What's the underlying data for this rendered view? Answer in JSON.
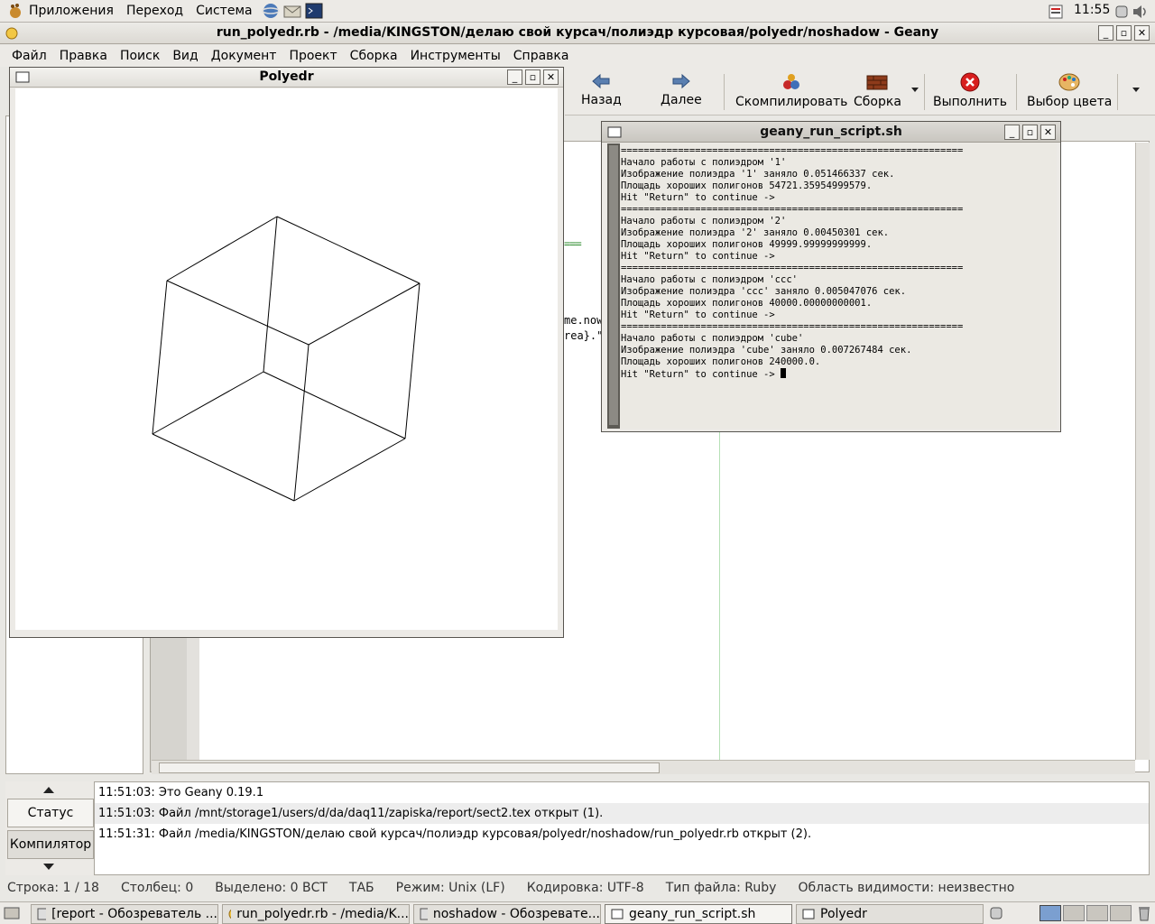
{
  "top_panel": {
    "menus": [
      "Приложения",
      "Переход",
      "Система"
    ],
    "clock": "11:55"
  },
  "geany": {
    "title": "run_polyedr.rb - /media/KINGSTON/делаю свой курсач/полиэдр курсовая/polyedr/noshadow - Geany",
    "menu": [
      "Файл",
      "Правка",
      "Поиск",
      "Вид",
      "Документ",
      "Проект",
      "Сборка",
      "Инструменты",
      "Справка"
    ],
    "toolbar": {
      "back": "Назад",
      "forward": "Далее",
      "compile": "Скомпилировать",
      "build": "Сборка",
      "execute": "Выполнить",
      "color": "Выбор цвета"
    },
    "code_fragments": [
      "me.now",
      "rea}.\""
    ],
    "messages": {
      "tabs": [
        "Статус",
        "Компилятор"
      ],
      "lines": [
        "11:51:03: Это Geany 0.19.1",
        "11:51:03: Файл /mnt/storage1/users/d/da/daq11/zapiska/report/sect2.tex открыт (1).",
        "11:51:31: Файл /media/KINGSTON/делаю свой курсач/полиэдр курсовая/polyedr/noshadow/run_polyedr.rb открыт (2)."
      ]
    },
    "statusbar": {
      "line": "Строка: 1 / 18",
      "col": "Столбец: 0",
      "sel": "Выделено: 0 ВСТ",
      "tab": "ТАБ",
      "mode": "Режим: Unix (LF)",
      "encoding": "Кодировка: UTF-8",
      "filetype": "Тип файла: Ruby",
      "scope": "Область видимости: неизвестно"
    }
  },
  "polyedr_window": {
    "title": "Polyedr"
  },
  "terminal": {
    "title": "geany_run_script.sh",
    "lines": [
      "============================================================",
      "Начало работы с полиэдром '1'",
      "Изображение полиэдра '1' заняло 0.051466337 сек.",
      "Площадь хороших полигонов 54721.35954999579.",
      "Hit \"Return\" to continue ->",
      "============================================================",
      "Начало работы с полиэдром '2'",
      "Изображение полиэдра '2' заняло 0.00450301 сек.",
      "Площадь хороших полигонов 49999.99999999999.",
      "Hit \"Return\" to continue ->",
      "============================================================",
      "Начало работы с полиэдром 'ccc'",
      "Изображение полиэдра 'ccc' заняло 0.005047076 сек.",
      "Площадь хороших полигонов 40000.00000000001.",
      "Hit \"Return\" to continue ->",
      "============================================================",
      "Начало работы с полиэдром 'cube'",
      "Изображение полиэдра 'cube' заняло 0.007267484 сек.",
      "Площадь хороших полигонов 240000.0.",
      "Hit \"Return\" to continue -> "
    ]
  },
  "taskbar": [
    "[report - Обозреватель ...",
    "run_polyedr.rb - /media/K...",
    "noshadow - Обозревате...",
    "geany_run_script.sh",
    "Polyedr"
  ],
  "colors": {
    "panel_bg": "#eceae6",
    "editor_guide": "#b6e0b6",
    "error_red": "#d81e1e"
  }
}
